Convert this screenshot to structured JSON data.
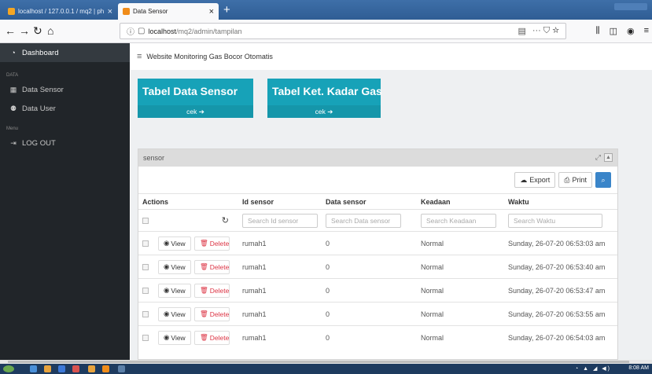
{
  "browser": {
    "tabs": [
      {
        "label": "localhost / 127.0.0.1 / mq2 | ph"
      },
      {
        "label": "Data Sensor"
      }
    ],
    "new_tab_icon": "plus-icon",
    "url_host": "localhost",
    "url_path": "/mq2/admin/tampilan",
    "url_actions": "··· ⛉ ☆"
  },
  "sidebar": {
    "items": [
      {
        "label": "Dashboard",
        "icon": "tachometer-icon"
      },
      {
        "label": "Data Sensor",
        "icon": "table-icon"
      },
      {
        "label": "Data User",
        "icon": "users-icon"
      },
      {
        "label": "LOG OUT",
        "icon": "sign-out-icon"
      }
    ],
    "headings": [
      "DATA",
      "Menu"
    ]
  },
  "topbar": {
    "title": "Website Monitoring Gas Bocor Otomatis"
  },
  "cards": [
    {
      "title": "Tabel Data Sensor",
      "link": "cek",
      "color": "#17a2b8"
    },
    {
      "title": "Tabel Ket. Kadar Gas",
      "link": "cek",
      "color": "#17a2b8"
    }
  ],
  "panel": {
    "title": "sensor",
    "export_label": "Export",
    "print_label": "Print"
  },
  "table": {
    "columns": [
      "Actions",
      "Id sensor",
      "Data sensor",
      "Keadaan",
      "Waktu"
    ],
    "placeholders": [
      "Search Id sensor",
      "Search Data sensor",
      "Search Keadaan",
      "Search Waktu"
    ],
    "view_label": "View",
    "delete_label": "Delete",
    "rows": [
      {
        "id": "rumah1",
        "data": "0",
        "keadaan": "Normal",
        "waktu": "Sunday, 26-07-20 06:53:03 am"
      },
      {
        "id": "rumah1",
        "data": "0",
        "keadaan": "Normal",
        "waktu": "Sunday, 26-07-20 06:53:40 am"
      },
      {
        "id": "rumah1",
        "data": "0",
        "keadaan": "Normal",
        "waktu": "Sunday, 26-07-20 06:53:47 am"
      },
      {
        "id": "rumah1",
        "data": "0",
        "keadaan": "Normal",
        "waktu": "Sunday, 26-07-20 06:53:55 am"
      },
      {
        "id": "rumah1",
        "data": "0",
        "keadaan": "Normal",
        "waktu": "Sunday, 26-07-20 06:54:03 am"
      }
    ]
  },
  "taskbar": {
    "clock": "8:08 AM"
  },
  "colors": {
    "accent": "#17a2b8",
    "sidebar": "#212529",
    "danger": "#dc3545",
    "primary": "#3a85c9"
  }
}
